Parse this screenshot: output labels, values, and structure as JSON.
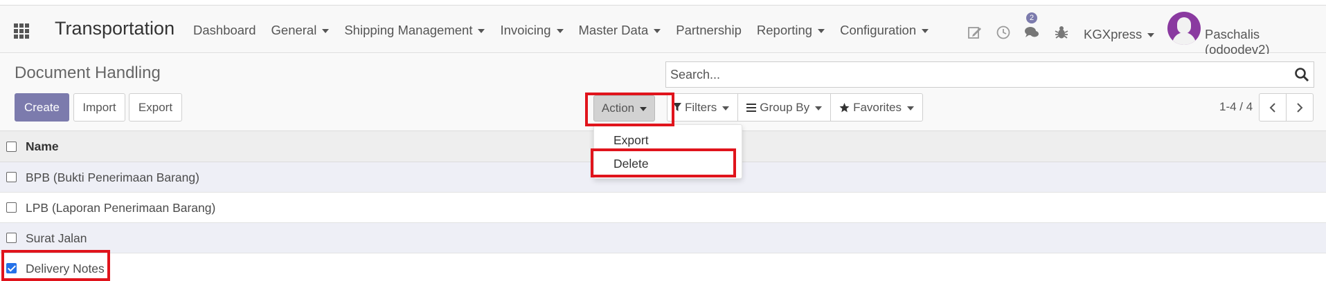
{
  "navbar": {
    "brand": "Transportation",
    "menu": [
      {
        "label": "Dashboard",
        "has_caret": false
      },
      {
        "label": "General",
        "has_caret": true
      },
      {
        "label": "Shipping Management",
        "has_caret": true
      },
      {
        "label": "Invoicing",
        "has_caret": true
      },
      {
        "label": "Master Data",
        "has_caret": true
      },
      {
        "label": "Partnership",
        "has_caret": false
      },
      {
        "label": "Reporting",
        "has_caret": true
      },
      {
        "label": "Configuration",
        "has_caret": true
      }
    ],
    "messages_badge": "2",
    "company": "KGXpress",
    "user": "Paschalis (odoodev2)"
  },
  "control_panel": {
    "breadcrumb": "Document Handling",
    "search_placeholder": "Search...",
    "buttons": {
      "create": "Create",
      "import": "Import",
      "export": "Export"
    },
    "action": "Action",
    "filters": "Filters",
    "group_by": "Group By",
    "favorites": "Favorites",
    "pager": "1-4 / 4"
  },
  "list": {
    "column": "Name",
    "rows": [
      {
        "name": "BPB (Bukti Penerimaan Barang)",
        "checked": false
      },
      {
        "name": "LPB (Laporan Penerimaan Barang)",
        "checked": false
      },
      {
        "name": "Surat Jalan",
        "checked": false
      },
      {
        "name": "Delivery Notes",
        "checked": true
      }
    ]
  },
  "action_menu": {
    "items": [
      "Export",
      "Delete"
    ]
  },
  "colors": {
    "primary": "#7c7bad",
    "highlight": "#e0141c",
    "checkbox_checked": "#2571e8"
  }
}
